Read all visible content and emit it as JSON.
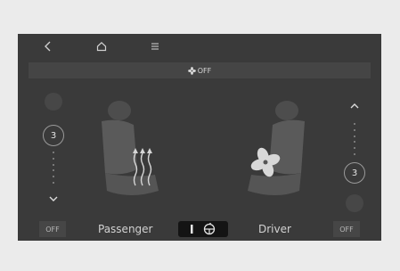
{
  "top_nav": {
    "back_icon": "chevron-left-icon",
    "home_icon": "home-icon",
    "menu_icon": "menu-icon"
  },
  "fan_status": {
    "icon": "fan-icon",
    "text": "OFF"
  },
  "passenger": {
    "level": "3",
    "label": "Passenger",
    "off_label": "OFF",
    "mode": "seat-heating"
  },
  "driver": {
    "level": "3",
    "label": "Driver",
    "off_label": "OFF",
    "mode": "seat-ventilation"
  },
  "sync_button": {
    "icons": [
      "toggle-bar-icon",
      "steering-wheel-icon"
    ]
  }
}
